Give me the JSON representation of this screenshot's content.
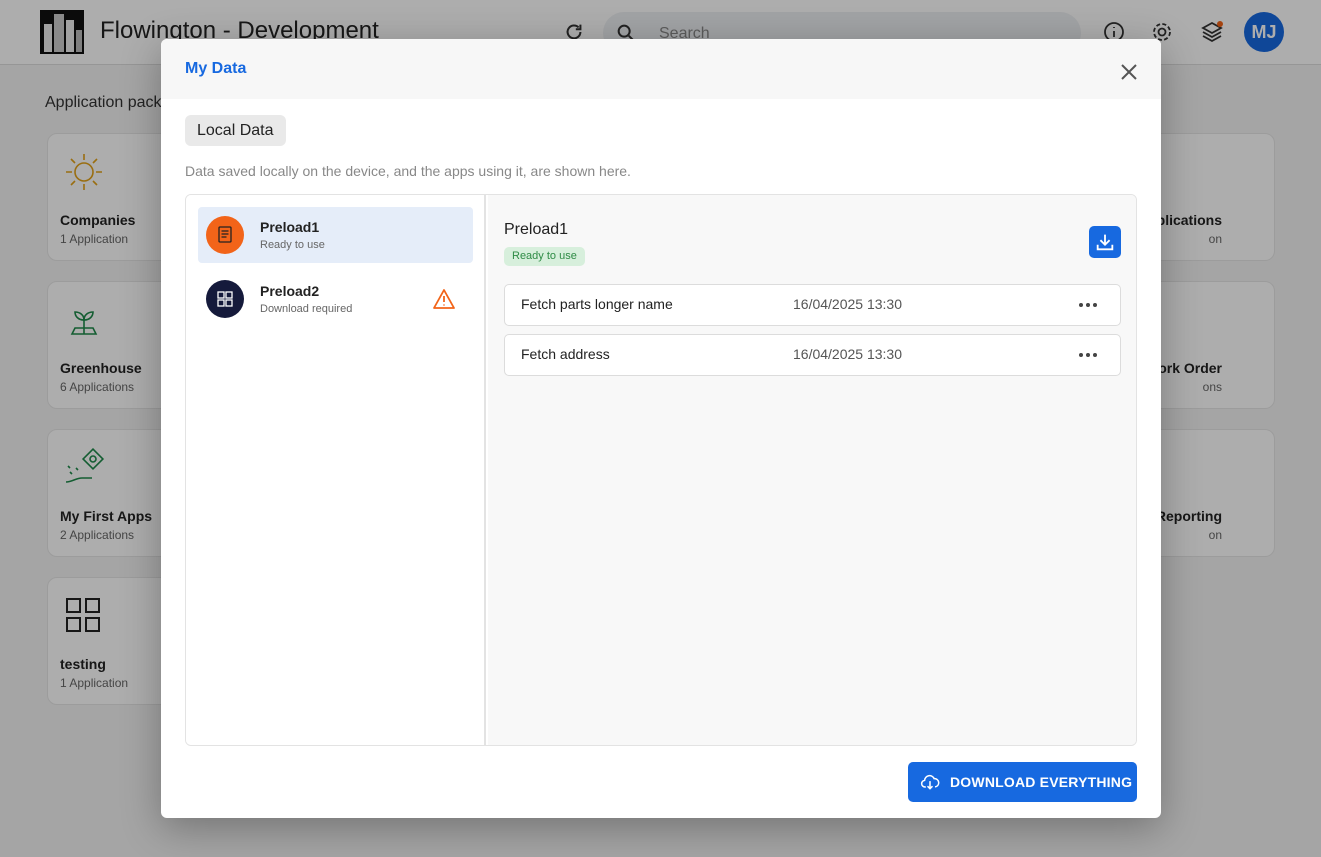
{
  "app": {
    "title": "Flowington - Development",
    "search_placeholder": "Search",
    "avatar_initials": "MJ",
    "section_label": "Application pack",
    "cards_left": [
      {
        "name": "Companies",
        "count": "1 Application",
        "icon": "sun-icon"
      },
      {
        "name": "Greenhouse",
        "count": "6 Applications",
        "icon": "plant-icon"
      },
      {
        "name": "My First Apps",
        "count": "2 Applications",
        "icon": "money-hand-icon"
      },
      {
        "name": "testing",
        "count": "1 Application",
        "icon": "grid-icon"
      }
    ],
    "cards_right": [
      {
        "name": "plications",
        "count": "on"
      },
      {
        "name": "ork Order",
        "count": "ons"
      },
      {
        "name": "or Reporting",
        "count": "on"
      }
    ]
  },
  "modal": {
    "title": "My Data",
    "tab_label": "Local Data",
    "description": "Data saved locally on the device, and the apps using it, are shown here.",
    "list": [
      {
        "name": "Preload1",
        "status": "Ready to use",
        "icon": "document-icon",
        "color": "#f26419",
        "selected": true
      },
      {
        "name": "Preload2",
        "status": "Download required",
        "icon": "grid-icon",
        "color": "#151a3b",
        "warning": true
      }
    ],
    "detail": {
      "title": "Preload1",
      "badge": "Ready to use",
      "rows": [
        {
          "name": "Fetch parts longer name",
          "date": "16/04/2025 13:30"
        },
        {
          "name": "Fetch address",
          "date": "16/04/2025 13:30"
        }
      ]
    },
    "download_all_label": "DOWNLOAD EVERYTHING"
  },
  "colors": {
    "accent": "#1769e0",
    "warning": "#f26419",
    "success_bg": "#d7efdc",
    "success_text": "#2e8b45"
  }
}
